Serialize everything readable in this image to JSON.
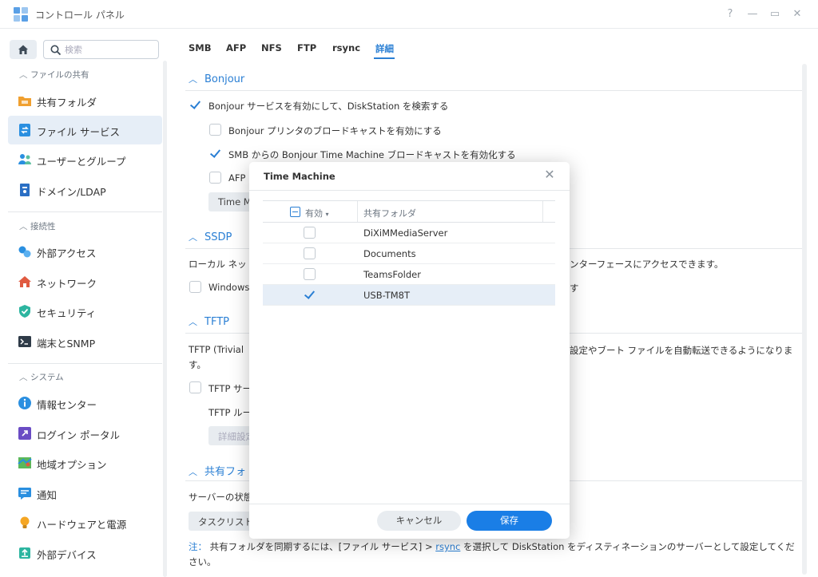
{
  "window": {
    "title": "コントロール パネル",
    "controls": [
      "?",
      "—",
      "▭",
      "✕"
    ]
  },
  "sidebar": {
    "search_placeholder": "検索",
    "groups": [
      {
        "label": "ファイルの共有",
        "items": [
          {
            "label": "共有フォルダ",
            "icon": "shared-folder-icon",
            "active": false
          },
          {
            "label": "ファイル サービス",
            "icon": "file-services-icon",
            "active": true
          },
          {
            "label": "ユーザーとグループ",
            "icon": "users-icon",
            "active": false
          },
          {
            "label": "ドメイン/LDAP",
            "icon": "domain-icon",
            "active": false
          }
        ]
      },
      {
        "label": "接続性",
        "items": [
          {
            "label": "外部アクセス",
            "icon": "external-access-icon"
          },
          {
            "label": "ネットワーク",
            "icon": "network-icon"
          },
          {
            "label": "セキュリティ",
            "icon": "shield-icon"
          },
          {
            "label": "端末とSNMP",
            "icon": "terminal-icon"
          }
        ]
      },
      {
        "label": "システム",
        "items": [
          {
            "label": "情報センター",
            "icon": "info-icon"
          },
          {
            "label": "ログイン ポータル",
            "icon": "login-portal-icon"
          },
          {
            "label": "地域オプション",
            "icon": "map-icon"
          },
          {
            "label": "通知",
            "icon": "notification-icon"
          },
          {
            "label": "ハードウェアと電源",
            "icon": "bulb-icon"
          },
          {
            "label": "外部デバイス",
            "icon": "external-device-icon"
          }
        ]
      }
    ]
  },
  "tabs": [
    "SMB",
    "AFP",
    "NFS",
    "FTP",
    "rsync",
    "詳細"
  ],
  "main": {
    "bonjour": {
      "title": "Bonjour",
      "enable": "Bonjour サービスを有効にして、DiskStation を検索する",
      "printer": "Bonjour プリンタのブロードキャストを有効にする",
      "smb_tm": "SMB からの Bonjour Time Machine ブロードキャストを有効化する",
      "afp_tm": "AFP",
      "tm_button": "Time M"
    },
    "ssdp": {
      "title": "SSDP",
      "desc_left": "ローカル ネッ",
      "desc_right": "ンターフェースにアクセスできます。",
      "windows_left": "Windows",
      "windows_right": "す"
    },
    "tftp": {
      "title": "TFTP",
      "desc_line1_left": "TFTP (Trivial",
      "desc_line1_right": "設定やブート ファイルを自動転送できるようになりま",
      "desc_line2": "す。",
      "enable": "TFTP サー",
      "root": "TFTP ルー",
      "advanced": "詳細設定"
    },
    "shared_sync": {
      "title": "共有フォ",
      "status": "サーバーの状態",
      "task_list": "タスクリスト"
    },
    "note": {
      "lead": "注：",
      "text_before": "共有フォルダを同期するには、[ファイル サービス] > ",
      "link": "rsync",
      "text_after": " を選択して DiskStation をディスティネーションのサーバーとして設定してください。"
    }
  },
  "modal": {
    "title": "Time Machine",
    "columns": {
      "enabled": "有効",
      "shared_folder": "共有フォルダ"
    },
    "rows": [
      {
        "name": "DiXiMMediaServer",
        "checked": false
      },
      {
        "name": "Documents",
        "checked": false
      },
      {
        "name": "TeamsFolder",
        "checked": false
      },
      {
        "name": "USB-TM8T",
        "checked": true
      }
    ],
    "cancel": "キャンセル",
    "save": "保存"
  },
  "colors": {
    "accent": "#2a7fd4",
    "primary_button": "#1a7ee6",
    "selection": "#e6eef7"
  }
}
